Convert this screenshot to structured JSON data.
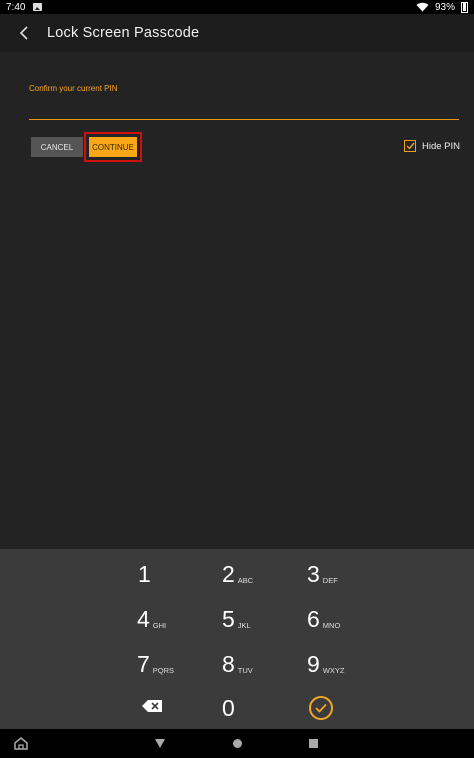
{
  "status": {
    "time": "7:40",
    "battery": "93%"
  },
  "app_bar": {
    "title": "Lock Screen Passcode"
  },
  "pin_form": {
    "label": "Confirm your current PIN",
    "value": "",
    "cancel_label": "CANCEL",
    "continue_label": "CONTINUE",
    "hide_pin_label": "Hide PIN",
    "hide_pin_checked": true
  },
  "keypad": {
    "keys": [
      {
        "num": "1",
        "letters": ""
      },
      {
        "num": "2",
        "letters": "ABC"
      },
      {
        "num": "3",
        "letters": "DEF"
      },
      {
        "num": "4",
        "letters": "GHI"
      },
      {
        "num": "5",
        "letters": "JKL"
      },
      {
        "num": "6",
        "letters": "MNO"
      },
      {
        "num": "7",
        "letters": "PQRS"
      },
      {
        "num": "8",
        "letters": "TUV"
      },
      {
        "num": "9",
        "letters": "WXYZ"
      },
      {
        "num": "0",
        "letters": ""
      }
    ],
    "backspace_icon": "backspace-icon",
    "done_icon": "check-circle-icon"
  },
  "colors": {
    "accent": "#f5a623",
    "highlight": "#d20f0f",
    "background": "#232323",
    "keypad": "#3b3b3b"
  }
}
